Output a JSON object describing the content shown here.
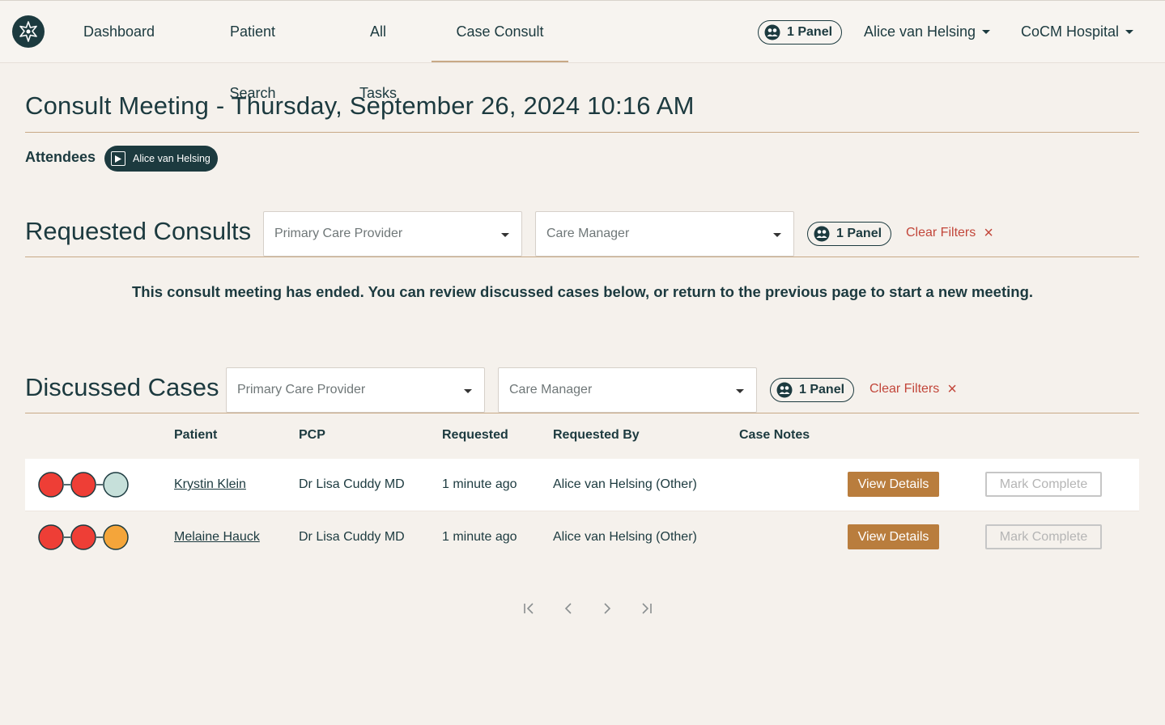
{
  "nav": {
    "items": [
      {
        "label": "Dashboard"
      },
      {
        "label": "Patient Search"
      },
      {
        "label": "All Tasks"
      },
      {
        "label": "Case Consult"
      }
    ],
    "panel_label": "1 Panel",
    "user_name": "Alice van Helsing",
    "org_name": "CoCM Hospital"
  },
  "meeting": {
    "title": "Consult Meeting - Thursday, September 26, 2024 10:16 AM",
    "attendees_label": "Attendees",
    "attendees": [
      "Alice van Helsing"
    ]
  },
  "requested": {
    "title": "Requested Consults",
    "pcp_placeholder": "Primary Care Provider",
    "cm_placeholder": "Care Manager",
    "panel_label": "1 Panel",
    "clear_label": "Clear Filters",
    "message": "This consult meeting has ended. You can review discussed cases below, or return to the previous page to start a new meeting."
  },
  "discussed": {
    "title": "Discussed Cases",
    "pcp_placeholder": "Primary Care Provider",
    "cm_placeholder": "Care Manager",
    "panel_label": "1 Panel",
    "clear_label": "Clear Filters",
    "columns": [
      "Patient",
      "PCP",
      "Requested",
      "Requested By",
      "Case Notes"
    ],
    "rows": [
      {
        "status_colors": [
          "#ee3e36",
          "#ee3e36",
          "#c6e0da"
        ],
        "patient": "Krystin Klein",
        "pcp": "Dr Lisa Cuddy MD",
        "requested": "1 minute ago",
        "requested_by": "Alice van Helsing (Other)",
        "case_notes": "",
        "details_label": "View Details",
        "complete_label": "Mark Complete"
      },
      {
        "status_colors": [
          "#ee3e36",
          "#ee3e36",
          "#f4a53a"
        ],
        "patient": "Melaine Hauck",
        "pcp": "Dr Lisa Cuddy MD",
        "requested": "1 minute ago",
        "requested_by": "Alice van Helsing (Other)",
        "case_notes": "",
        "details_label": "View Details",
        "complete_label": "Mark Complete"
      }
    ]
  },
  "colors": {
    "primary": "#1c3a3f",
    "accent": "#b97d3d",
    "danger": "#c2463a",
    "background": "#f5f1ec"
  }
}
